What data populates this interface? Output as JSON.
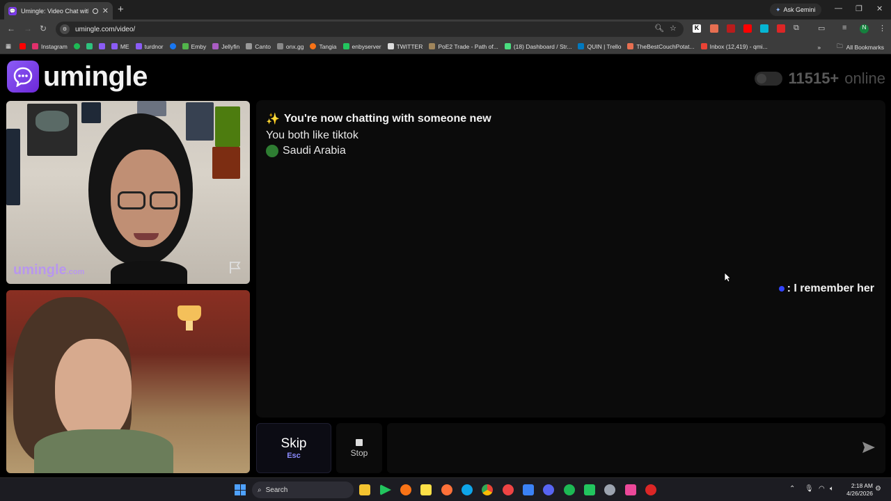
{
  "browser": {
    "tab_title": "Umingle: Video Chat with S",
    "new_tab": "+",
    "close_tab": "✕",
    "ask_gemini": "Ask Gemini",
    "url": "umingle.com/video/",
    "all_bookmarks": "All Bookmarks",
    "bookmarks": [
      {
        "label": "Instagram",
        "color": "#e1306c"
      },
      {
        "label": "",
        "color": "#1db954"
      },
      {
        "label": "",
        "color": "#2ec27e"
      },
      {
        "label": "",
        "color": "#8b5cf6"
      },
      {
        "label": "ME",
        "color": "#8b5cf6"
      },
      {
        "label": "turdnor",
        "color": "#8b5cf6"
      },
      {
        "label": "",
        "color": "#1877f2"
      },
      {
        "label": "Emby",
        "color": "#52b54b"
      },
      {
        "label": "Jellyfin",
        "color": "#aa5cc3"
      },
      {
        "label": "Canto",
        "color": "#999999"
      },
      {
        "label": "onx.gg",
        "color": "#888888"
      },
      {
        "label": "Tangia",
        "color": "#f97316"
      },
      {
        "label": "enbyserver",
        "color": "#22c55e"
      },
      {
        "label": "TWITTER",
        "color": "#dddddd"
      },
      {
        "label": "PoE2 Trade - Path of...",
        "color": "#a0855b"
      },
      {
        "label": "(18) Dashboard / Str...",
        "color": "#4ade80"
      },
      {
        "label": "QUIN | Trello",
        "color": "#0079bf"
      },
      {
        "label": "TheBestCouchPotat...",
        "color": "#e76f51"
      },
      {
        "label": "Inbox (12,419) - qmi...",
        "color": "#ea4335"
      }
    ]
  },
  "site": {
    "logo_text": "umingle",
    "online_count": "11515+",
    "online_word": "online"
  },
  "video": {
    "watermark": "umingle",
    "watermark_suffix": ".com"
  },
  "chat": {
    "system_icon": "✨",
    "system_title": "You're now chatting with someone new",
    "common_interest": "You both like tiktok",
    "country": "Saudi Arabia",
    "messages": [
      {
        "text": ": I remember her"
      }
    ]
  },
  "controls": {
    "skip_label": "Skip",
    "skip_key": "Esc",
    "stop_label": "Stop",
    "input_placeholder": ""
  },
  "taskbar": {
    "search_label": "Search",
    "time": "2:18 AM",
    "date": "4/26/2026"
  }
}
